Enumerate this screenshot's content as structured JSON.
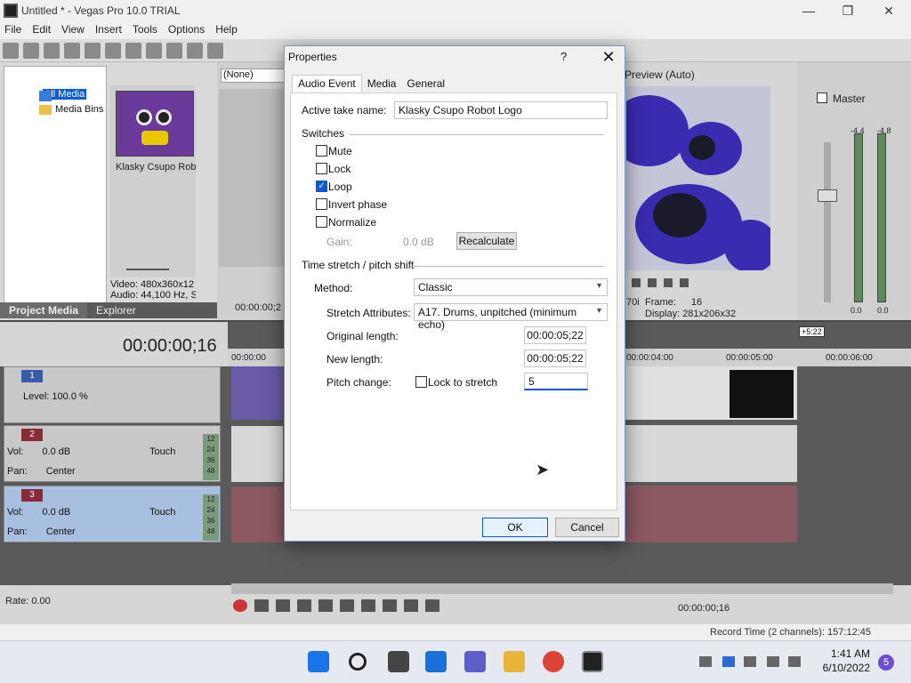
{
  "window": {
    "title": "Untitled * - Vegas Pro 10.0 TRIAL",
    "minimize": "—",
    "maximize": "❐",
    "close": "✕"
  },
  "menu": [
    "File",
    "Edit",
    "View",
    "Insert",
    "Tools",
    "Options",
    "Help"
  ],
  "explorer": {
    "tree_items": [
      "All Media",
      "Media Bins"
    ],
    "thumbnail_caption": "Klasky Csupo Rob...",
    "media_info_video": "Video: 480x360x12",
    "media_info_audio": "Audio: 44,100 Hz, S",
    "tabs": [
      "Project Media",
      "Explorer"
    ]
  },
  "trimmer": {
    "selector": "(None)",
    "timecode": "00:00:00;2"
  },
  "preview": {
    "label": "Preview (Auto)",
    "frame_label": "Frame:",
    "frame_value": "16",
    "display_label": "Display:",
    "display_value": "281x206x32",
    "res_prefix": "70i"
  },
  "master": {
    "label": "Master",
    "meter_left_top": "-4.4",
    "meter_right_top": "-4.8",
    "scale": [
      "6",
      "12",
      "18",
      "24",
      "30",
      "36",
      "42",
      "48",
      "54",
      "57"
    ],
    "bottom_left": "0.0",
    "bottom_right": "0.0"
  },
  "timeline": {
    "timecode": "00:00:00;16",
    "ruler": [
      "00:00:00",
      "00:00:04:00",
      "00:00:05:00",
      "00:00:06:00"
    ],
    "ruler_marker": "+5:22",
    "tracks": [
      {
        "num": "1",
        "level_label": "Level:",
        "level_value": "100.0 %"
      },
      {
        "num": "2",
        "vol_label": "Vol:",
        "vol_value": "0.0 dB",
        "pan_label": "Pan:",
        "pan_value": "Center",
        "mode": "Touch",
        "meter": [
          "12",
          "24",
          "36",
          "48"
        ]
      },
      {
        "num": "3",
        "vol_label": "Vol:",
        "vol_value": "0.0 dB",
        "pan_label": "Pan:",
        "pan_value": "Center",
        "mode": "Touch",
        "meter": [
          "12",
          "24",
          "36",
          "48"
        ]
      }
    ],
    "rate": "Rate: 0.00",
    "transport_timecode": "00:00:00;16"
  },
  "status": {
    "record_time": "Record Time (2 channels): 157:12:45"
  },
  "taskbar": {
    "time": "1:41 AM",
    "date": "6/10/2022",
    "notifications": "5"
  },
  "dialog": {
    "title": "Properties",
    "help": "?",
    "close": "✕",
    "tabs": [
      "Audio Event",
      "Media",
      "General"
    ],
    "active_take_label": "Active take name:",
    "active_take_value": "Klasky Csupo Robot Logo",
    "switches_header": "Switches",
    "switches": [
      {
        "label": "Mute",
        "checked": false
      },
      {
        "label": "Lock",
        "checked": false
      },
      {
        "label": "Loop",
        "checked": true
      },
      {
        "label": "Invert phase",
        "checked": false
      },
      {
        "label": "Normalize",
        "checked": false
      }
    ],
    "gain_label": "Gain:",
    "gain_value": "0.0 dB",
    "recalculate": "Recalculate",
    "stretch_header": "Time stretch / pitch shift",
    "method_label": "Method:",
    "method_value": "Classic",
    "stretch_attr_label": "Stretch Attributes:",
    "stretch_attr_value": "A17. Drums, unpitched (minimum echo)",
    "original_length_label": "Original length:",
    "original_length_value": "00:00:05;22",
    "new_length_label": "New length:",
    "new_length_value": "00:00:05;22",
    "pitch_change_label": "Pitch change:",
    "lock_to_stretch_label": "Lock to stretch",
    "pitch_change_value": "5",
    "ok": "OK",
    "cancel": "Cancel"
  }
}
